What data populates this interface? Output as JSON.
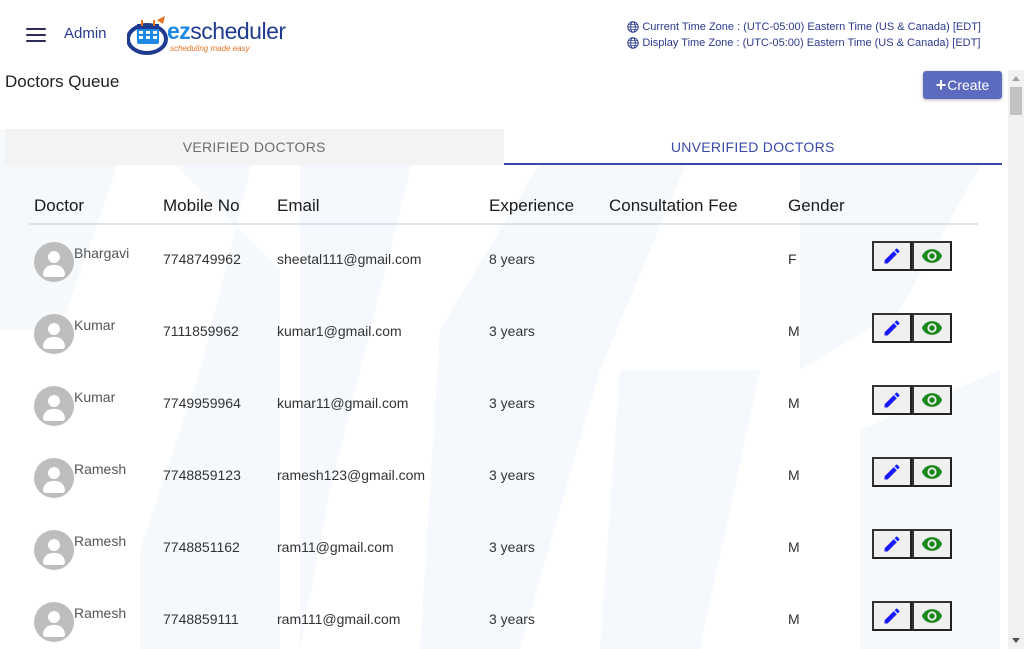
{
  "header": {
    "admin_label": "Admin",
    "logo": {
      "ez": "ez",
      "rest": "scheduler",
      "tagline": "scheduling made easy"
    },
    "timezones": {
      "current": "Current Time Zone : (UTC-05:00) Eastern Time (US & Canada) [EDT]",
      "display": "Display Time Zone : (UTC-05:00) Eastern Time (US & Canada) [EDT]"
    }
  },
  "page": {
    "title": "Doctors Queue",
    "create_label": "Create"
  },
  "tabs": [
    {
      "label": "VERIFIED DOCTORS",
      "active": false
    },
    {
      "label": "UNVERIFIED DOCTORS",
      "active": true
    }
  ],
  "table": {
    "columns": [
      "Doctor",
      "Mobile No",
      "Email",
      "Experience",
      "Consultation Fee",
      "Gender"
    ],
    "rows": [
      {
        "doctor": "Bhargavi",
        "mobile": "7748749962",
        "email": "sheetal111@gmail.com",
        "experience": "8 years",
        "fee": "",
        "gender": "F"
      },
      {
        "doctor": "Kumar",
        "mobile": "7111859962",
        "email": "kumar1@gmail.com",
        "experience": "3 years",
        "fee": "",
        "gender": "M"
      },
      {
        "doctor": "Kumar",
        "mobile": "7749959964",
        "email": "kumar11@gmail.com",
        "experience": "3 years",
        "fee": "",
        "gender": "M"
      },
      {
        "doctor": "Ramesh",
        "mobile": "7748859123",
        "email": "ramesh123@gmail.com",
        "experience": "3 years",
        "fee": "",
        "gender": "M"
      },
      {
        "doctor": "Ramesh",
        "mobile": "7748851162",
        "email": "ram11@gmail.com",
        "experience": "3 years",
        "fee": "",
        "gender": "M"
      },
      {
        "doctor": "Ramesh",
        "mobile": "7748859111",
        "email": "ram111@gmail.com",
        "experience": "3 years",
        "fee": "",
        "gender": "M"
      }
    ]
  },
  "icons": {
    "menu": "hamburger-menu-icon",
    "globe": "globe-icon",
    "edit": "pencil-icon",
    "view": "eye-icon",
    "avatar": "person-icon"
  },
  "colors": {
    "accent": "#3949ab",
    "create_button": "#5c6bc0",
    "edit_icon": "#1a1aff",
    "view_icon": "#1b8a1b"
  }
}
